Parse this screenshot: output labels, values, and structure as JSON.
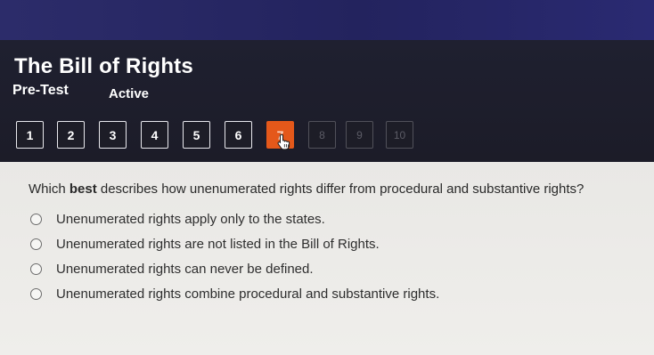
{
  "header": {
    "title": "The Bill of Rights",
    "subtitle": "Pre-Test",
    "status": "Active"
  },
  "question_nav": [
    {
      "label": "1",
      "state": "answered"
    },
    {
      "label": "2",
      "state": "answered"
    },
    {
      "label": "3",
      "state": "answered"
    },
    {
      "label": "4",
      "state": "answered"
    },
    {
      "label": "5",
      "state": "answered"
    },
    {
      "label": "6",
      "state": "answered"
    },
    {
      "label": "7",
      "state": "current"
    },
    {
      "label": "8",
      "state": "locked"
    },
    {
      "label": "9",
      "state": "locked"
    },
    {
      "label": "10",
      "state": "locked"
    }
  ],
  "question": {
    "text_before": "Which ",
    "emphasis": "best",
    "text_after": " describes how unenumerated rights differ from procedural and substantive rights?"
  },
  "choices": [
    "Unenumerated rights apply only to the states.",
    "Unenumerated rights are not listed in the Bill of Rights.",
    "Unenumerated rights can never be defined.",
    "Unenumerated rights combine procedural and substantive rights."
  ],
  "colors": {
    "header_bg": "#1e1f2c",
    "top_bar": "#27276a",
    "current_question": "#e4581a",
    "content_bg": "#ecebe8"
  },
  "icons": {
    "cursor": "hand-pointer-icon",
    "choice_marker": "radio-button"
  }
}
